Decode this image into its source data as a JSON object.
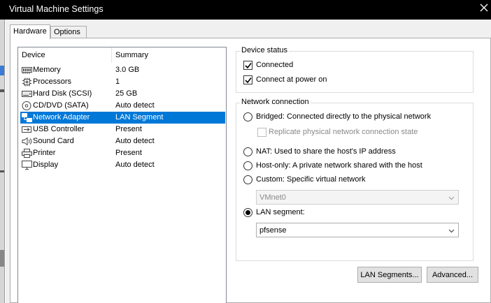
{
  "window": {
    "title": "Virtual Machine Settings",
    "close_icon": "close-icon"
  },
  "tabs": [
    {
      "label": "Hardware",
      "active": true
    },
    {
      "label": "Options",
      "active": false
    }
  ],
  "devices": {
    "headers": {
      "device": "Device",
      "summary": "Summary"
    },
    "items": [
      {
        "name": "Memory",
        "summary": "3.0 GB",
        "icon": "memory-icon"
      },
      {
        "name": "Processors",
        "summary": "1",
        "icon": "processor-icon"
      },
      {
        "name": "Hard Disk (SCSI)",
        "summary": "25 GB",
        "icon": "hard-disk-icon"
      },
      {
        "name": "CD/DVD (SATA)",
        "summary": "Auto detect",
        "icon": "cd-dvd-icon"
      },
      {
        "name": "Network Adapter",
        "summary": "LAN Segment",
        "icon": "network-adapter-icon",
        "selected": true
      },
      {
        "name": "USB Controller",
        "summary": "Present",
        "icon": "usb-icon"
      },
      {
        "name": "Sound Card",
        "summary": "Auto detect",
        "icon": "speaker-icon"
      },
      {
        "name": "Printer",
        "summary": "Present",
        "icon": "printer-icon"
      },
      {
        "name": "Display",
        "summary": "Auto detect",
        "icon": "display-icon"
      }
    ]
  },
  "device_status": {
    "legend": "Device status",
    "connected": {
      "label": "Connected",
      "checked": true
    },
    "connect_at_power_on": {
      "label": "Connect at power on",
      "checked": true
    }
  },
  "network_connection": {
    "legend": "Network connection",
    "bridged": {
      "label": "Bridged: Connected directly to the physical network",
      "selected": false
    },
    "replicate": {
      "label": "Replicate physical network connection state",
      "checked": false,
      "disabled": true
    },
    "nat": {
      "label": "NAT: Used to share the host's IP address",
      "selected": false
    },
    "host_only": {
      "label": "Host-only: A private network shared with the host",
      "selected": false
    },
    "custom": {
      "label": "Custom: Specific virtual network",
      "selected": false
    },
    "custom_network": {
      "value": "VMnet0",
      "disabled": true
    },
    "lan_segment": {
      "label": "LAN segment:",
      "selected": true
    },
    "lan_segment_value": {
      "value": "pfsense"
    }
  },
  "buttons": {
    "lan_segments": "LAN Segments...",
    "advanced": "Advanced..."
  },
  "colors": {
    "selection": "#0078d7",
    "titlebar": "#000000",
    "dialog_bg": "#f0f0f0"
  }
}
